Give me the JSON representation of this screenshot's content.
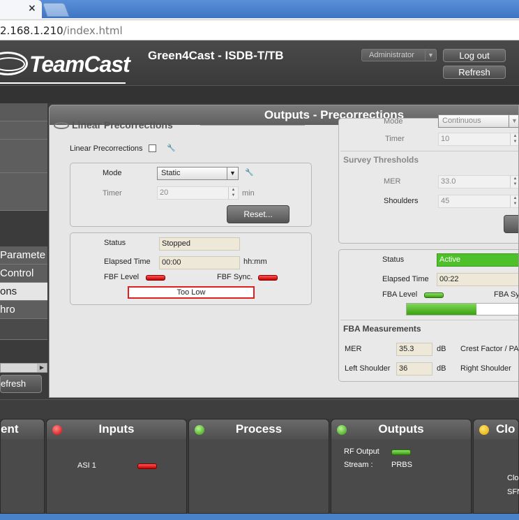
{
  "browser": {
    "tab_close": "×",
    "url_host": "2.168.1.210",
    "url_path": "/index.html"
  },
  "header": {
    "logo_text": "TeamCast",
    "product": "Green4Cast  - ISDB-T/TB",
    "role": "Administrator",
    "logout_label": "Log out",
    "refresh_label": "Refresh"
  },
  "left_menu": {
    "items": [
      {
        "label": "Paramete",
        "selected": false
      },
      {
        "label": "Control",
        "selected": false
      },
      {
        "label": "ons",
        "selected": true
      },
      {
        "label": "hro",
        "selected": false
      }
    ],
    "refresh_label": "efresh"
  },
  "main": {
    "title": "Outputs - Precorrections",
    "linear": {
      "section_title": "Linear Precorrections",
      "enable_label": "Linear Precorrections",
      "mode_label": "Mode",
      "mode_value": "Static",
      "timer_label": "Timer",
      "timer_value": "20",
      "timer_unit": "min",
      "reset_label": "Reset...",
      "status_label": "Status",
      "status_value": "Stopped",
      "elapsed_label": "Elapsed Time",
      "elapsed_value": "00:00",
      "elapsed_unit": "hh:mm",
      "fbf_level_label": "FBF Level",
      "fbf_sync_label": "FBF Sync.",
      "level_bar_text": "Too Low"
    },
    "nonlinear": {
      "mode_label": "Mode",
      "mode_value": "Continuous",
      "timer_label": "Timer",
      "timer_value": "10",
      "survey_title": "Survey Thresholds",
      "mer_label": "MER",
      "mer_value": "33.0",
      "shoulders_label": "Shoulders",
      "shoulders_value": "45",
      "status_label": "Status",
      "status_value": "Active",
      "elapsed_label": "Elapsed Time",
      "elapsed_value": "00:22",
      "fba_level_label": "FBA Level",
      "fba_sync_label": "FBA Sync",
      "fba_level_fill": 0.62,
      "meas_title": "FBA Measurements",
      "meas_mer_label": "MER",
      "meas_mer_value": "35.3",
      "meas_mer_unit": "dB",
      "crest_label": "Crest Factor / PAR",
      "left_shoulder_label": "Left Shoulder",
      "left_shoulder_value": "36",
      "left_shoulder_unit": "dB",
      "right_shoulder_label": "Right Shoulder"
    }
  },
  "bottom": {
    "panel0_title": "ent",
    "inputs_title": "Inputs",
    "inputs_asi": "ASI 1",
    "process_title": "Process",
    "outputs_title": "Outputs",
    "outputs_rf": "RF Output",
    "outputs_stream_label": "Stream :",
    "outputs_stream_value": "PRBS",
    "clock_title": "Clo",
    "clock_l1": "Clo",
    "clock_l2": "SFN"
  }
}
